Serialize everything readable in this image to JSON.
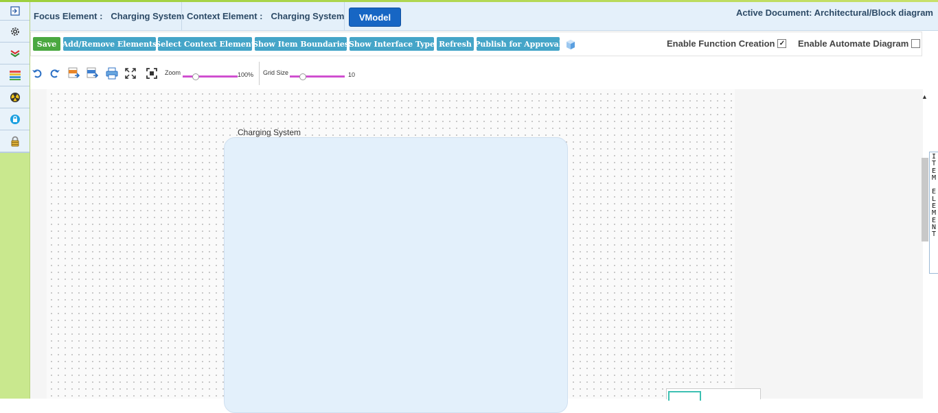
{
  "header": {
    "focus_label": "Focus Element :",
    "focus_value": "Charging System",
    "context_label": "Context Element :",
    "context_value": "Charging System",
    "vmodel_label": "VModel",
    "active_document": "Active Document: Architectural/Block diagram"
  },
  "sidebar": {
    "icons": [
      "expand-icon",
      "gear-icon",
      "layers-icon",
      "stack-icon",
      "radiation-icon",
      "lock-badge-icon",
      "padlock-icon"
    ]
  },
  "toolbar": {
    "save": "Save",
    "add_remove": "Add/Remove Elements",
    "select_context": "Select Context Element",
    "show_boundaries": "Show Item Boundaries",
    "show_interface": "Show Interface Type",
    "refresh": "Refresh",
    "publish": "Publish for Approval",
    "enable_function_creation": "Enable Function Creation",
    "enable_function_creation_checked": true,
    "enable_automate_diagram": "Enable Automate Diagram",
    "enable_automate_diagram_checked": false
  },
  "toolbar2": {
    "zoom_label": "Zoom",
    "zoom_value": "100%",
    "grid_label": "Grid Size",
    "grid_value": "10"
  },
  "canvas": {
    "block_label": "Charging System"
  },
  "side_tab": {
    "letters": [
      "I",
      "T",
      "E",
      "M",
      "",
      "E",
      "L",
      "E",
      "M",
      "E",
      "N",
      "T"
    ]
  },
  "colors": {
    "save_button": "#4aa840",
    "action_buttons": "#45a5c8",
    "vmodel_button": "#1766c4",
    "sidebar": "#c9e88e",
    "block_fill": "#e3f0fb"
  }
}
